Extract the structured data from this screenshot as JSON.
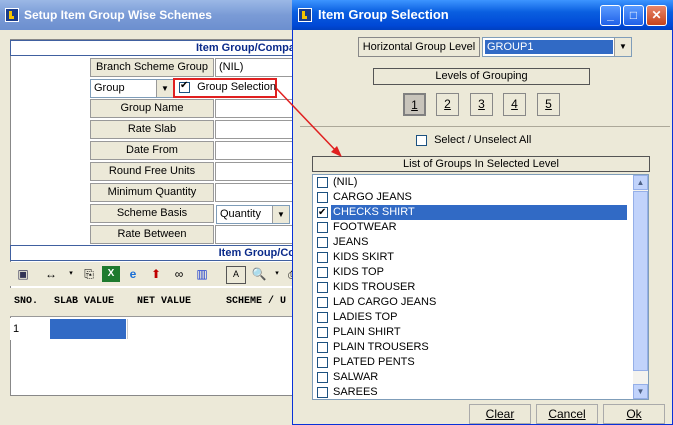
{
  "back_window": {
    "title": "Setup Item Group Wise Schemes",
    "section_header": "Item Group/Compa",
    "branch_scheme_group_label": "Branch Scheme Group",
    "branch_scheme_group_value": "(NIL)",
    "group_combo_value": "Group",
    "group_selection_label": "Group Selection",
    "fields": [
      {
        "label": "Group Name"
      },
      {
        "label": "Rate Slab"
      },
      {
        "label": "Date From"
      },
      {
        "label": "Round Free Units"
      },
      {
        "label": "Minimum Quantity"
      },
      {
        "label": "Scheme Basis",
        "value": "Quantity"
      },
      {
        "label": "Rate Between"
      }
    ],
    "grid_header": "Item Group/Co",
    "grid_columns": [
      "SNO.",
      "SLAB VALUE",
      "NET VALUE",
      "SCHEME / U"
    ],
    "grid_rows": [
      {
        "sno": "1"
      }
    ]
  },
  "dialog": {
    "title": "Item Group Selection",
    "horizontal_group_level_label": "Horizontal Group Level",
    "horizontal_group_level_value": "GROUP1",
    "levels_label": "Levels of Grouping",
    "levels": [
      "1",
      "2",
      "3",
      "4",
      "5"
    ],
    "selected_level": "1",
    "select_all_label": "Select / Unselect All",
    "list_header": "List of Groups In Selected Level",
    "items": [
      {
        "label": "(NIL)",
        "checked": false
      },
      {
        "label": "CARGO JEANS",
        "checked": false
      },
      {
        "label": "CHECKS SHIRT",
        "checked": true
      },
      {
        "label": "FOOTWEAR",
        "checked": false
      },
      {
        "label": "JEANS",
        "checked": false
      },
      {
        "label": "KIDS SKIRT",
        "checked": false
      },
      {
        "label": "KIDS TOP",
        "checked": false
      },
      {
        "label": "KIDS TROUSER",
        "checked": false
      },
      {
        "label": "LAD CARGO JEANS",
        "checked": false
      },
      {
        "label": "LADIES TOP",
        "checked": false
      },
      {
        "label": "PLAIN SHIRT",
        "checked": false
      },
      {
        "label": "PLAIN TROUSERS",
        "checked": false
      },
      {
        "label": "PLATED PENTS",
        "checked": false
      },
      {
        "label": "SALWAR",
        "checked": false
      },
      {
        "label": "SAREES",
        "checked": false
      }
    ],
    "buttons": {
      "clear": "Clear",
      "cancel": "Cancel",
      "ok": "Ok"
    }
  },
  "colors": {
    "selection": "#316ac5",
    "annotation": "#e02020",
    "title_blue": "#0a5fe0"
  }
}
